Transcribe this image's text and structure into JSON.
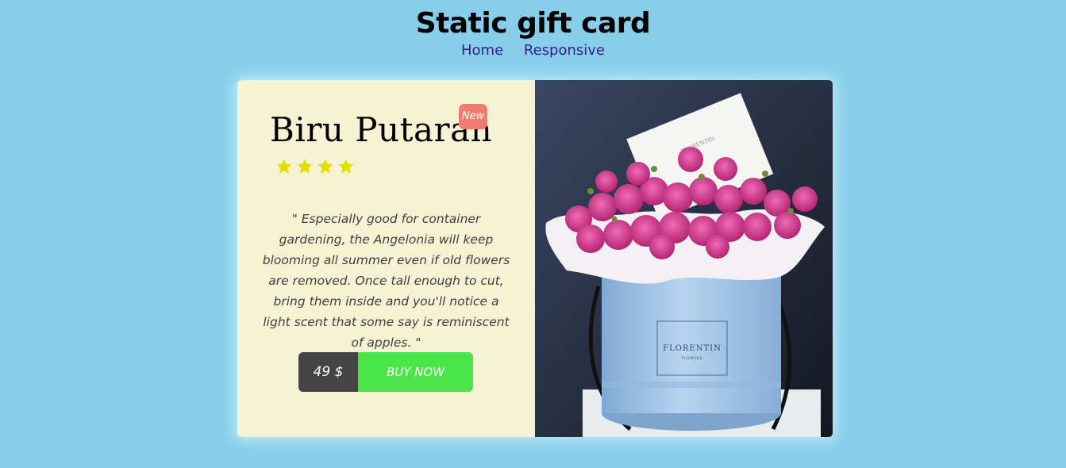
{
  "header": {
    "title": "Static gift card",
    "nav": [
      {
        "label": "Home"
      },
      {
        "label": "Responsive"
      }
    ]
  },
  "card": {
    "product_name": "Biru Putaran",
    "badge": "New",
    "rating": 4,
    "description": "\" Especially good for container gardening, the Angelonia will keep blooming all summer even if old flowers are removed. Once tall enough to cut, bring them inside and you'll notice a light scent that some say is reminiscent of apples. \"",
    "price": "49 $",
    "buy_label": "BUY NOW",
    "image": {
      "box_brand": "FLORENTIN",
      "box_sub": "FLOWERS",
      "card_text": "FLORENTIN"
    }
  },
  "colors": {
    "background": "#87ceea",
    "card_left": "#f6f2d4",
    "badge": "#f07b6e",
    "star": "#e2e000",
    "price_bg": "#444444",
    "buy_bg": "#4ae546",
    "nav_link": "#3b1a8f"
  }
}
